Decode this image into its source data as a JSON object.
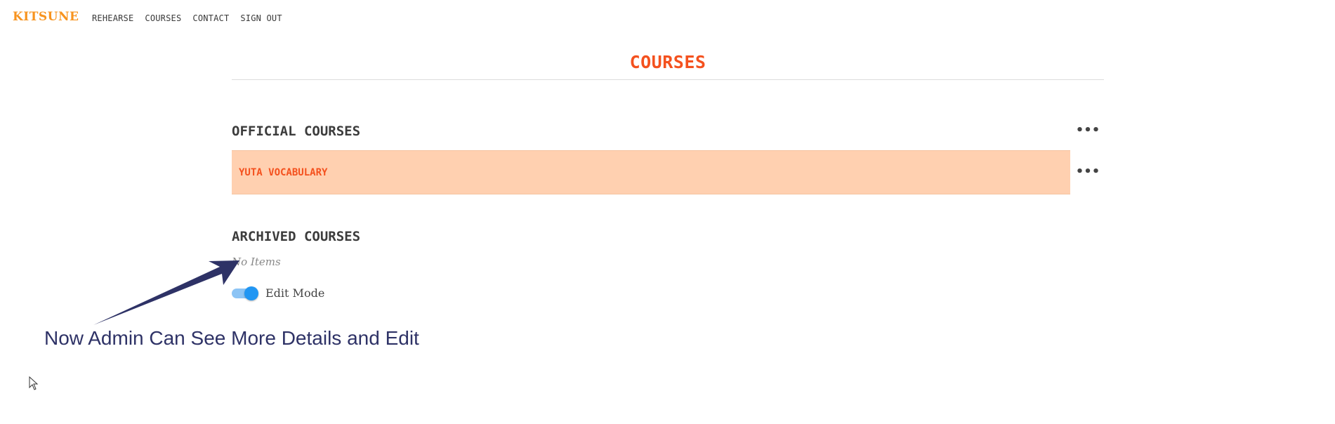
{
  "nav": {
    "logo": "KITSUNE",
    "links": [
      "REHEARSE",
      "COURSES",
      "CONTACT",
      "SIGN OUT"
    ]
  },
  "page": {
    "title": "COURSES"
  },
  "official": {
    "heading": "OFFICIAL COURSES",
    "more_icon": "more-horizontal-icon",
    "courses": [
      {
        "label": "YUTA VOCABULARY"
      }
    ]
  },
  "archived": {
    "heading": "ARCHIVED COURSES",
    "empty_text": "No Items"
  },
  "edit_mode": {
    "label": "Edit Mode",
    "enabled": true
  },
  "annotation": {
    "text": "Now Admin Can See More Details and Edit"
  },
  "colors": {
    "accent": "#f4511e",
    "logo": "#f7931e",
    "course_bg": "#ffd0b0",
    "toggle": "#2196f3",
    "annotation": "#2e3266"
  }
}
